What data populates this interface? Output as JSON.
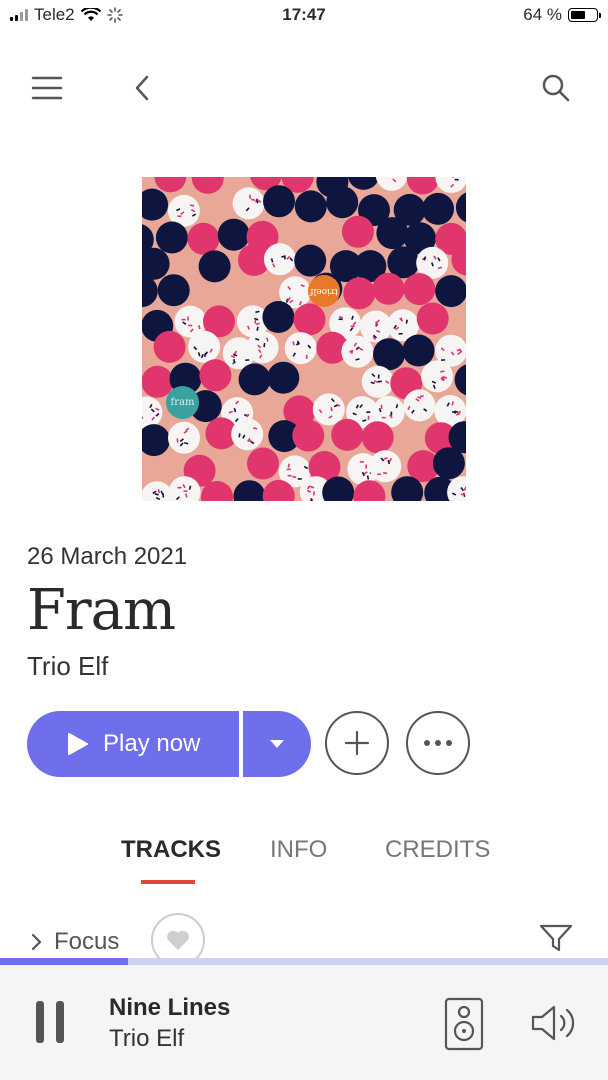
{
  "status_bar": {
    "carrier": "Tele2",
    "time": "17:47",
    "battery_text": "64 %",
    "battery_level": 0.64
  },
  "nav": {
    "menu_icon": "hamburger-menu-icon",
    "back_icon": "chevron-left-icon",
    "search_icon": "search-icon"
  },
  "album": {
    "release_date": "26 March 2021",
    "title": "Fram",
    "artist": "Trio Elf",
    "cover_text_orange": "trioelf",
    "cover_text_teal": "fram"
  },
  "actions": {
    "play_label": "Play now",
    "dropdown_icon": "caret-down-icon",
    "add_icon": "plus-icon",
    "more_icon": "more-dots-icon"
  },
  "tabs": [
    {
      "label": "TRACKS",
      "active": true
    },
    {
      "label": "INFO",
      "active": false
    },
    {
      "label": "CREDITS",
      "active": false
    }
  ],
  "filter": {
    "focus_label": "Focus",
    "heart_icon": "heart-icon",
    "filter_icon": "filter-icon"
  },
  "now_playing": {
    "title": "Nine Lines",
    "artist": "Trio Elf",
    "progress": 0.21
  },
  "colors": {
    "accent": "#6f6fec",
    "tab_underline": "#e0463a",
    "cover_background": "#e8a797",
    "cover_pink": "#e0356d",
    "cover_navy": "#0e1640",
    "cover_orange": "#e8782a",
    "cover_teal": "#3aa0a0"
  }
}
